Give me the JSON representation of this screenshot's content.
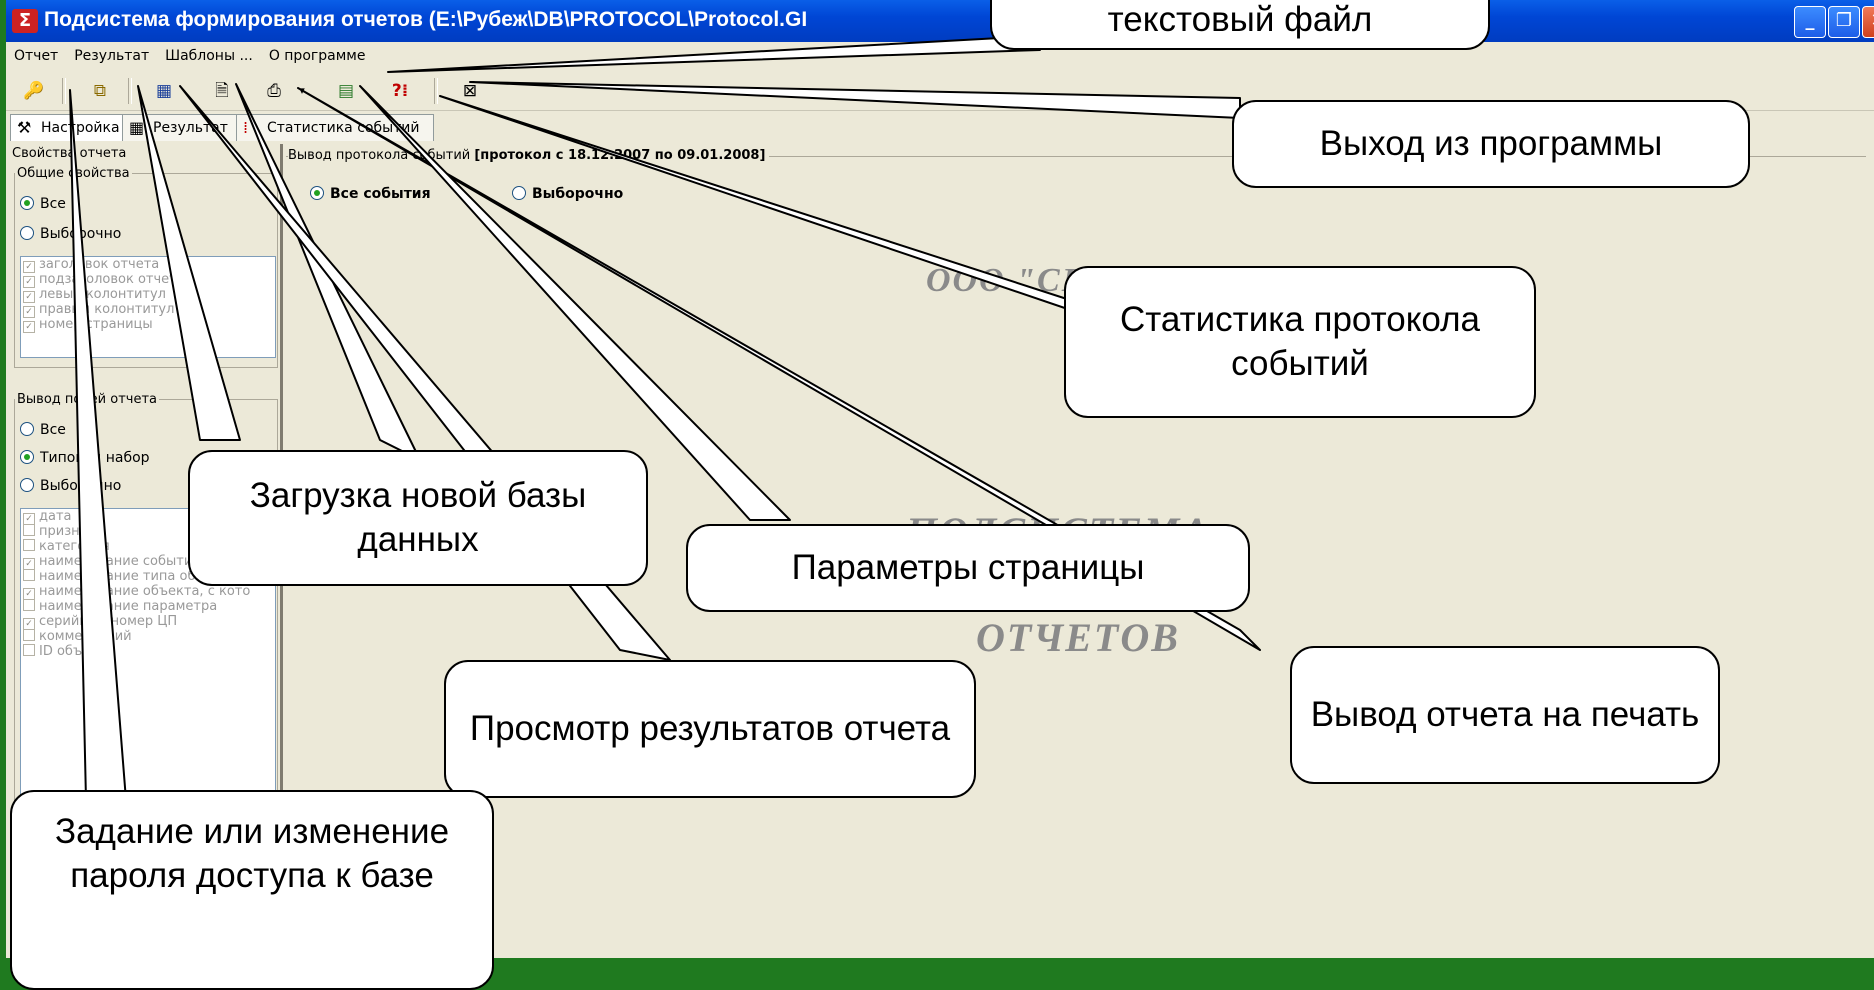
{
  "window": {
    "title": "Подсистема формирования отчетов (E:\\Рубеж\\DB\\PROTOCOL\\Protocol.GI"
  },
  "menu": [
    "Отчет",
    "Результат",
    "Шаблоны ...",
    "О программе"
  ],
  "tabs": [
    {
      "label": "Настройка"
    },
    {
      "label": "Результат"
    },
    {
      "label": "Статистика событий"
    }
  ],
  "left_panel": {
    "group_title": "Свойства отчета",
    "general_title": "Общие свойства",
    "general_options": [
      "Все",
      "Выборочно"
    ],
    "general_selected": "Все",
    "general_items": [
      "заголовок отчета",
      "подзаголовок отчета",
      "левый колонтитул",
      "правый колонтитул",
      "номер страницы"
    ],
    "output_title": "Вывод полей отчета",
    "output_options": [
      "Все",
      "Типовой набор",
      "Выборочно"
    ],
    "output_selected": "Типовой набор",
    "output_items": [
      {
        "label": "дата",
        "checked": true
      },
      {
        "label": "признак",
        "checked": false
      },
      {
        "label": "категория",
        "checked": false
      },
      {
        "label": "наименование события",
        "checked": true
      },
      {
        "label": "наименование типа объекта",
        "checked": false
      },
      {
        "label": "наименование объекта, с кото",
        "checked": true
      },
      {
        "label": "наименование параметра",
        "checked": false
      },
      {
        "label": "серийный номер ЦП",
        "checked": true
      },
      {
        "label": "комментарий",
        "checked": false
      },
      {
        "label": "ID объекта",
        "checked": false
      }
    ]
  },
  "right_panel": {
    "legend": "Вывод протокола событий",
    "legend_range": "[протокол с 18.12.2007 по 09.01.2008]",
    "radio_all": "Все события",
    "radio_selective": "Выборочно",
    "bg_line1": "ООО \"СИ...\"",
    "bg_line2": "ПОДСИСТЕМА",
    "bg_line3": "ОТЧЕТОВ"
  },
  "callouts": {
    "text_file": "текстовый файл",
    "exit": "Выход из программы",
    "statistics": "Статистика протокола событий",
    "load_db": "Загрузка новой базы данных",
    "page_params": "Параметры страницы",
    "view_results": "Просмотр результатов отчета",
    "print": "Вывод отчета на печать",
    "password": "Задание или изменение пароля доступа к базе"
  },
  "icons": [
    "key-icon",
    "open-db-icon",
    "table-icon",
    "page-icon",
    "printer-icon",
    "export-text-icon",
    "statistics-icon",
    "exit-icon"
  ]
}
